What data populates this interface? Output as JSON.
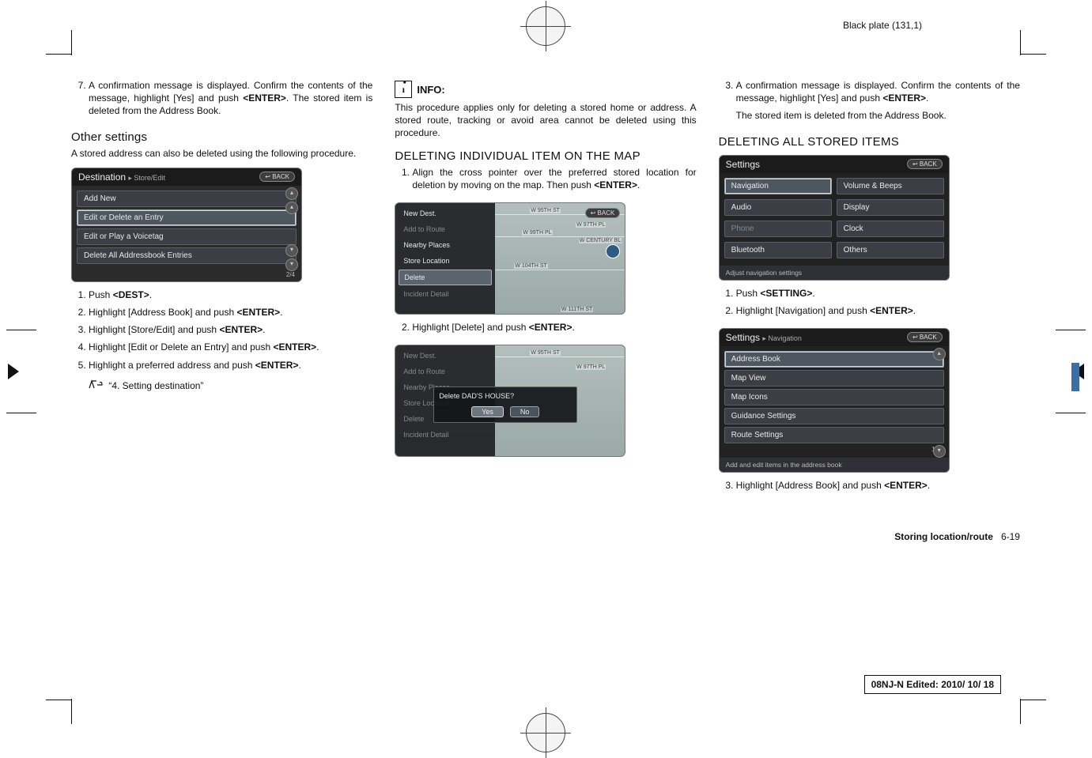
{
  "header_right": "Black plate (131,1)",
  "col1": {
    "step7": "A confirmation message is displayed. Confirm the contents of the message, highlight [Yes] and push <ENTER>. The stored item is deleted from the Address Book.",
    "other_settings_h": "Other settings",
    "other_settings_p": "A stored address can also be deleted using the following procedure.",
    "shot": {
      "title": "Destination",
      "crumb": "▸ Store/Edit",
      "back": "↩ BACK",
      "items": [
        "Add New",
        "Edit or Delete an Entry",
        "Edit or Play a Voicetag",
        "Delete All Addressbook Entries"
      ],
      "page": "2/4"
    },
    "steps": [
      "Push <DEST>.",
      "Highlight [Address Book] and push <ENTER>.",
      "Highlight [Store/Edit] and push <ENTER>.",
      "Highlight [Edit or Delete an Entry] and push <ENTER>.",
      "Highlight a preferred address and push <ENTER>."
    ],
    "ref": "“4. Setting destination”"
  },
  "col2": {
    "info_label": "INFO:",
    "info_text": "This procedure applies only for deleting a stored home or address. A stored route, tracking or avoid area cannot be deleted using this procedure.",
    "h": "DELETING INDIVIDUAL ITEM ON THE MAP",
    "step1": "Align the cross pointer over the preferred stored location for deletion by moving on the map. Then push <ENTER>.",
    "mapshot1": {
      "back": "↩ BACK",
      "items": [
        "New Dest.",
        "Add to Route",
        "Nearby Places",
        "Store Location",
        "Delete",
        "Incident Detail"
      ],
      "roads": [
        "W 95TH ST",
        "W 97TH PL",
        "W 99TH PL",
        "W CENTURY BL",
        "W 104TH ST",
        "W 111TH ST"
      ]
    },
    "step2": "Highlight [Delete] and push <ENTER>.",
    "mapshot2": {
      "items": [
        "New Dest.",
        "Add to Route",
        "Nearby Places",
        "Store Location",
        "Delete",
        "Incident Detail"
      ],
      "dialog_title": "Delete DAD'S HOUSE?",
      "yes": "Yes",
      "no": "No",
      "roads": [
        "W 95TH ST",
        "W 97TH PL"
      ]
    }
  },
  "col3": {
    "step3": "A confirmation message is displayed. Confirm the contents of the message, highlight [Yes] and push <ENTER>.",
    "step3b": "The stored item is deleted from the Address Book.",
    "h": "DELETING ALL STORED ITEMS",
    "setshot1": {
      "title": "Settings",
      "back": "↩ BACK",
      "left": [
        "Navigation",
        "Audio",
        "Phone",
        "Bluetooth"
      ],
      "right": [
        "Volume & Beeps",
        "Display",
        "Clock",
        "Others"
      ],
      "foot": "Adjust navigation settings"
    },
    "steps": [
      "Push <SETTING>.",
      "Highlight [Navigation] and push <ENTER>."
    ],
    "setshot2": {
      "title": "Settings",
      "crumb": "▸ Navigation",
      "back": "↩ BACK",
      "items": [
        "Address Book",
        "Map View",
        "Map Icons",
        "Guidance Settings",
        "Route Settings"
      ],
      "page": "1/13",
      "foot": "Add and edit items in the address book"
    },
    "step3c": "Highlight [Address Book] and push <ENTER>."
  },
  "footer": {
    "section": "Storing location/route",
    "page": "6-19",
    "editbox": "08NJ-N Edited:  2010/ 10/ 18"
  }
}
